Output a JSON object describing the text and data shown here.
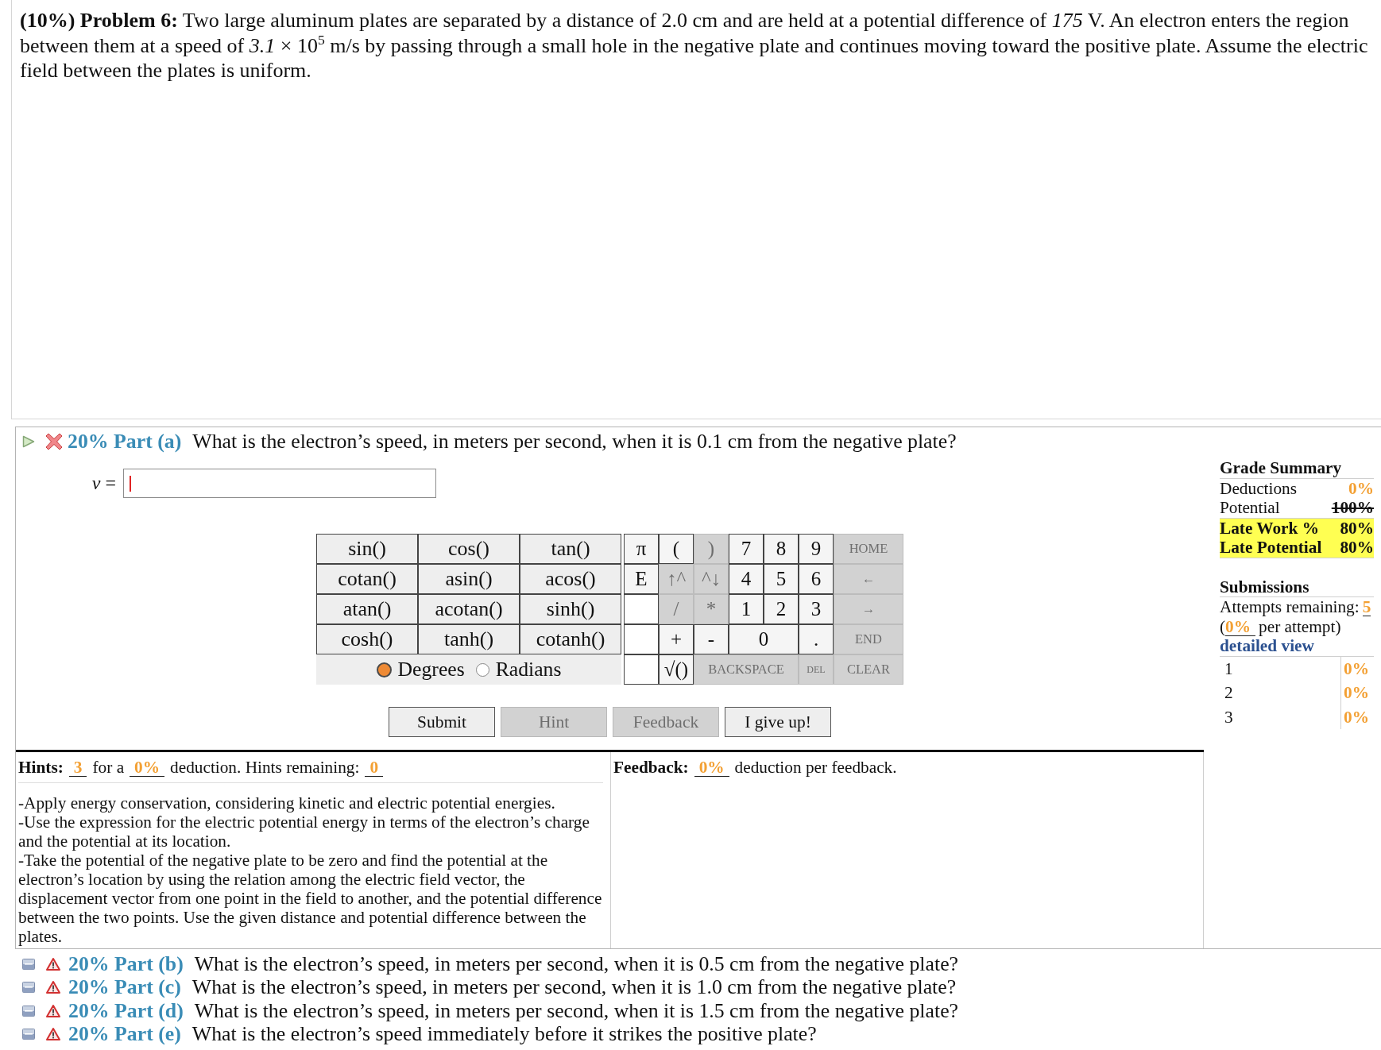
{
  "problem": {
    "text": "**(10%)  Problem 6:**  Two large aluminum plates are separated by a distance of 2.0 cm and are held at a potential difference of *175* V. An electron enters the region between them at a speed of *3.1* × 10$^{5}$ m/s by passing through a small hole in the negative plate and continues moving toward the positive plate. Assume the electric field between the plates is uniform."
  },
  "parts": [
    {
      "kind": "error",
      "label": "20% Part (a)",
      "question": "What is the electron’s speed, in meters per second, when it is 0.1 cm from the negative plate?",
      "expanded": true
    },
    {
      "kind": "warning",
      "label": "20% Part (b)",
      "question": "What is the electron’s speed, in meters per second, when it is 0.5 cm from the negative plate?",
      "expanded": false
    },
    {
      "kind": "warning",
      "label": "20% Part (c)",
      "question": "What is the electron’s speed, in meters per second, when it is 1.0 cm from the negative plate?",
      "expanded": false
    },
    {
      "kind": "warning",
      "label": "20% Part (d)",
      "question": "What is the electron’s speed, in meters per second, when it is 1.5 cm from the negative plate?",
      "expanded": false
    },
    {
      "kind": "warning",
      "label": "20% Part (e)",
      "question": "What is the electron’s speed immediately before it strikes the positive plate?",
      "expanded": false
    }
  ],
  "answer": {
    "label": "*v* =",
    "focused": true
  },
  "keypad": {
    "functions": [
      [
        "sin()",
        "cos()",
        "tan()"
      ],
      [
        "cotan()",
        "asin()",
        "acos()"
      ],
      [
        "atan()",
        "acotan()",
        "sinh()"
      ],
      [
        "cosh()",
        "tanh()",
        "cotanh()"
      ]
    ],
    "angle_modes": [
      {
        "label": "Degrees",
        "selected": true
      },
      {
        "label": "Radians",
        "selected": false
      }
    ],
    "keys": [
      [
        {
          "kind": "key",
          "label": "π",
          "disabled": false
        },
        {
          "kind": "key",
          "label": "(",
          "disabled": false
        },
        {
          "kind": "key",
          "label": ")",
          "disabled": true
        },
        {
          "kind": "key",
          "label": "7",
          "disabled": false
        },
        {
          "kind": "key",
          "label": "8",
          "disabled": false
        },
        {
          "kind": "key",
          "label": "9",
          "disabled": false
        },
        {
          "kind": "nav",
          "label": "HOME",
          "disabled": true
        }
      ],
      [
        {
          "kind": "key",
          "label": "E",
          "disabled": false
        },
        {
          "kind": "key",
          "label": "↑^",
          "disabled": true
        },
        {
          "kind": "key",
          "label": "^↓",
          "disabled": true
        },
        {
          "kind": "key",
          "label": "4",
          "disabled": false
        },
        {
          "kind": "key",
          "label": "5",
          "disabled": false
        },
        {
          "kind": "key",
          "label": "6",
          "disabled": false
        },
        {
          "kind": "nav",
          "label": "←",
          "disabled": true
        }
      ],
      [
        {
          "kind": "blank"
        },
        {
          "kind": "key",
          "label": "/",
          "disabled": true
        },
        {
          "kind": "key",
          "label": "*",
          "disabled": true
        },
        {
          "kind": "key",
          "label": "1",
          "disabled": false
        },
        {
          "kind": "key",
          "label": "2",
          "disabled": false
        },
        {
          "kind": "key",
          "label": "3",
          "disabled": false
        },
        {
          "kind": "nav",
          "label": "→",
          "disabled": true
        }
      ],
      [
        {
          "kind": "blank"
        },
        {
          "kind": "key",
          "label": "+",
          "disabled": false
        },
        {
          "kind": "key",
          "label": "-",
          "disabled": false
        },
        {
          "kind": "key",
          "label": "0",
          "disabled": false
        },
        {
          "kind": "key",
          "label": ".",
          "disabled": false
        },
        {
          "kind": "nav",
          "label": "END",
          "disabled": true
        }
      ],
      [
        {
          "kind": "blank"
        },
        {
          "kind": "key",
          "label": "√()",
          "disabled": false
        },
        {
          "kind": "nav",
          "label": "BACKSPACE",
          "disabled": true
        },
        {
          "kind": "nav",
          "label": "DEL",
          "disabled": true
        },
        {
          "kind": "nav",
          "label": "CLEAR",
          "disabled": true
        }
      ]
    ]
  },
  "buttons": [
    {
      "label": "Submit",
      "disabled": false
    },
    {
      "label": "Hint",
      "disabled": true
    },
    {
      "label": "Feedback",
      "disabled": true
    },
    {
      "label": "I give up!",
      "disabled": false
    }
  ],
  "grade_summary": {
    "title": "Grade Summary",
    "rows": [
      {
        "kind": "deduction",
        "label": "Deductions",
        "value": "0%"
      },
      {
        "kind": "struck",
        "label": "Potential",
        "value": "100%"
      },
      {
        "kind": "late",
        "label": "Late Work %",
        "value": "80%"
      },
      {
        "kind": "late",
        "label": "Late Potential",
        "value": "80%"
      }
    ]
  },
  "submissions": {
    "title": "Submissions",
    "attempts_label": "Attempts remaining:",
    "attempts": "5",
    "open_paren": "(",
    "per_attempt": "0%",
    "per_attempt_label": "per attempt)",
    "link": "detailed view",
    "rows": [
      {
        "number": "1",
        "value": "0%"
      },
      {
        "number": "2",
        "value": "0%"
      },
      {
        "number": "3",
        "value": "0%"
      }
    ]
  },
  "hints": {
    "label": "Hints:",
    "count": "3",
    "for_text": "for a",
    "deduction": "0%",
    "remaining_label": "deduction. Hints remaining:",
    "remaining": "0",
    "items": [
      "-Apply energy conservation, considering kinetic and electric potential energies.",
      "-Use the expression for the electric potential energy in terms of the electron’s charge and the potential at its location.",
      "-Take the potential of the negative plate to be zero and find the potential at the electron’s location by using the relation among the electric field vector, the displacement vector from one point in the field to another, and the potential difference between the two points. Use the given distance and potential difference between the plates."
    ]
  },
  "feedback": {
    "label": "Feedback:",
    "deduction": "0%",
    "text": "deduction per feedback."
  }
}
